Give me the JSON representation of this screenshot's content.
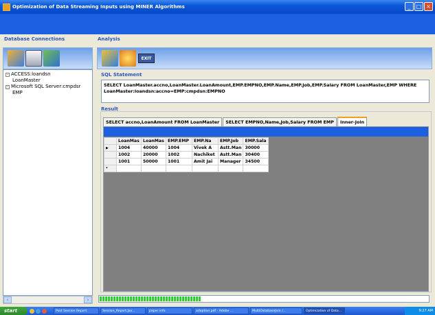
{
  "window": {
    "title": "Optimization of Data Streaming Inputs using MINER Algorithms"
  },
  "left": {
    "group_label": "Database Connections",
    "tree": [
      {
        "label": "ACCESS:loandsn",
        "expander": "⊟"
      },
      {
        "label": "LoanMaster"
      },
      {
        "label": "Microsoft SQL Server:cmpdsr",
        "expander": "⊟"
      },
      {
        "label": "EMP"
      }
    ]
  },
  "analysis": {
    "group_label": "Analysis",
    "exit_label": "EXIT",
    "sql_label": "SQL Statement",
    "sql_text": "SELECT LoanMaster.accno,LoanMaster.LoanAmount,EMP.EMPNO,EMP.Name,EMP.Job,EMP.Salary FROM LoanMaster,EMP WHERE LoanMaster:loandsn:accno=EMP:cmpdsn:EMPNO",
    "result_label": "Result",
    "tabs": [
      "SELECT accno,LoanAmount FROM LoanMaster",
      "SELECT EMPNO,Name,Job,Salary FROM EMP",
      "Inner-Join"
    ],
    "active_tab": 2,
    "grid": {
      "columns": [
        "LoanMas",
        "LoanMas",
        "EMP.EMP",
        "EMP.Na",
        "EMP.Job",
        "EMP.Sala"
      ],
      "rows": [
        [
          "1004",
          "40000",
          "1004",
          "Vivek A",
          "Astt.Man",
          "30000"
        ],
        [
          "1002",
          "20000",
          "1002",
          "Nachiket",
          "Astt.Man",
          "30400"
        ],
        [
          "1001",
          "50000",
          "1001",
          "Amit Jai",
          "Manager",
          "34500"
        ]
      ],
      "current_row_marker": "▶",
      "new_row_marker": "*"
    },
    "progress_fraction": 0.31
  },
  "taskbar": {
    "start_label": "start",
    "tasks": [
      "Post Session Report",
      "Session_Report.Jav...",
      "paper info",
      "adoption.pdf - Adobe ...",
      "MultiDatabaseJoin /...",
      "Optimization of Data..."
    ],
    "clock": "9:27 AM"
  },
  "colors": {
    "banner": "#1c5fe0",
    "group_label": "#2a56c0",
    "progress": "#2ed02e"
  }
}
